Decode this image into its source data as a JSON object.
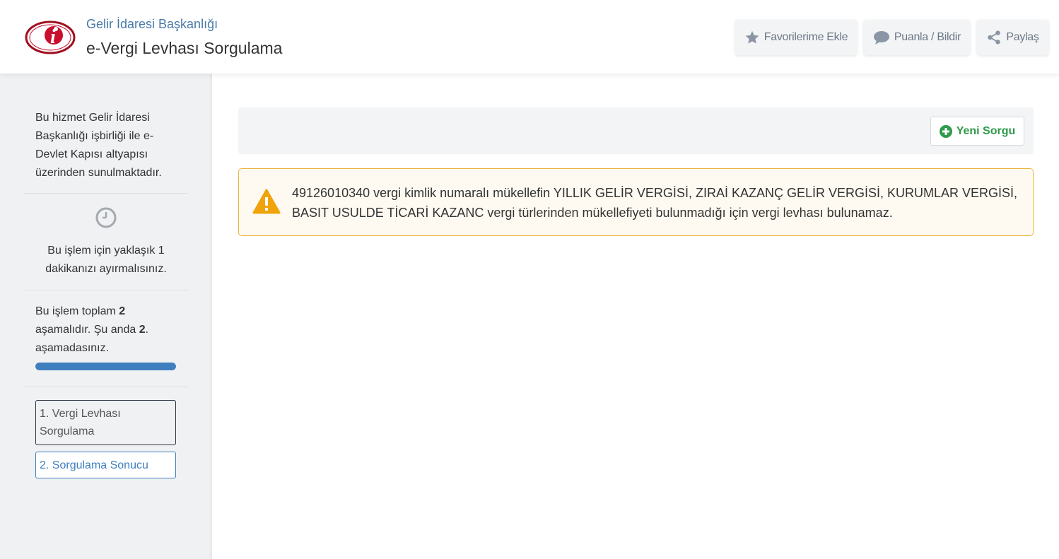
{
  "header": {
    "org_name": "Gelir İdaresi Başkanlığı",
    "page_title": "e-Vergi Levhası Sorgulama",
    "logo_icon": "gib-logo-icon",
    "buttons": {
      "favorite": "Favorilerime Ekle",
      "rate": "Puanla / Bildir",
      "share": "Paylaş"
    }
  },
  "sidebar": {
    "info": "Bu hizmet Gelir İdaresi Başkanlığı işbirliği ile e-Devlet Kapısı altyapısı üzerinden sunulmaktadır.",
    "time": "Bu işlem için yaklaşık 1 dakikanızı ayırmalısınız.",
    "steps_prefix": "Bu işlem toplam ",
    "steps_total": "2",
    "steps_middle": " aşamalıdır. Şu anda ",
    "steps_current": "2",
    "steps_suffix": ". aşamadasınız.",
    "progress_fraction": 1.0,
    "step_items": [
      {
        "label": "1. Vergi Levhası Sorgulama",
        "active": false
      },
      {
        "label": "2. Sorgulama Sonucu",
        "active": true
      }
    ]
  },
  "main": {
    "new_query_label": "Yeni Sorgu",
    "alert_text": "49126010340 vergi kimlik numaralı mükellefin YILLIK GELİR VERGİSİ, ZIRAİ KAZANÇ GELİR VERGİSİ, KURUMLAR VERGİSİ, BASIT USULDE TİCARİ KAZANC vergi türlerinden mükellefiyeti bulunmadığı için vergi levhası bulunamaz."
  },
  "colors": {
    "accent_blue": "#3f7fbf",
    "success_green": "#2e9a4a",
    "warning_orange": "#f0a30a",
    "logo_red": "#c8102e"
  }
}
